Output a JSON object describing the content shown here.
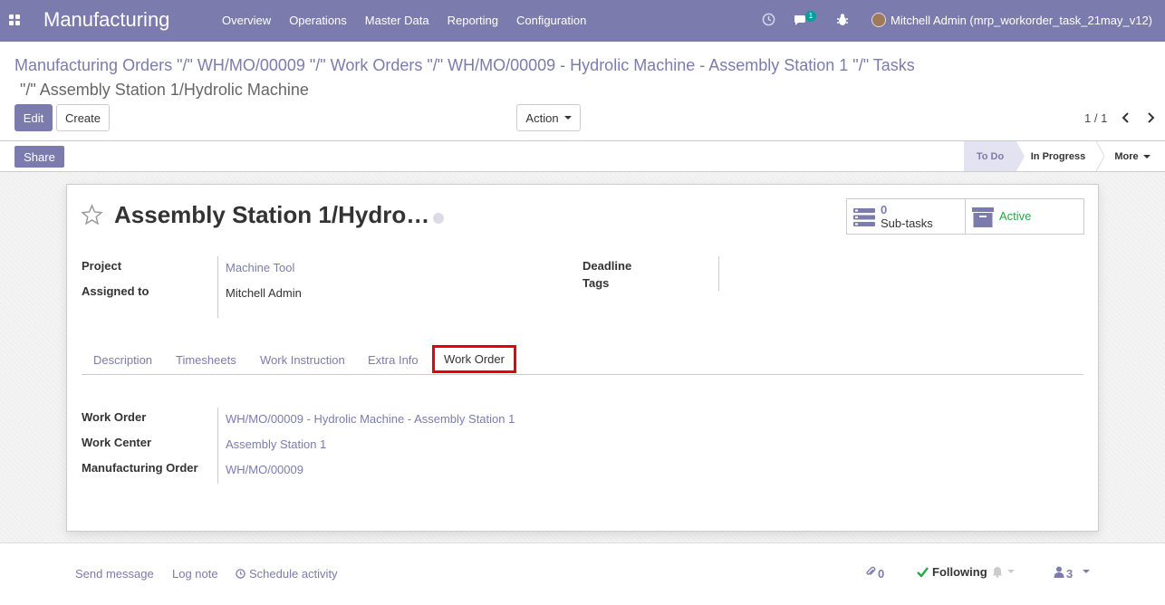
{
  "navbar": {
    "app_title": "Manufacturing",
    "menu": [
      "Overview",
      "Operations",
      "Master Data",
      "Reporting",
      "Configuration"
    ],
    "messages_badge": "1",
    "user_name": "Mitchell Admin (mrp_workorder_task_21may_v12)"
  },
  "breadcrumb": {
    "links": "Manufacturing Orders \"/\" WH/MO/00009 \"/\" Work Orders \"/\" WH/MO/00009 - Hydrolic Machine - Assembly Station 1 \"/\" Tasks",
    "current": "\"/\" Assembly Station 1/Hydrolic Machine"
  },
  "buttons": {
    "edit": "Edit",
    "create": "Create",
    "action": "Action",
    "share": "Share"
  },
  "pager": "1 / 1",
  "stages": {
    "todo": "To Do",
    "in_progress": "In Progress",
    "more": "More"
  },
  "record": {
    "title": "Assembly Station 1/Hydro…",
    "subtasks_count": "0",
    "subtasks_label": "Sub-tasks",
    "active_label": "Active"
  },
  "fields": {
    "project_label": "Project",
    "project_value": "Machine Tool",
    "assigned_label": "Assigned to",
    "assigned_value": "Mitchell Admin",
    "deadline_label": "Deadline",
    "tags_label": "Tags"
  },
  "tabs": [
    "Description",
    "Timesheets",
    "Work Instruction",
    "Extra Info",
    "Work Order"
  ],
  "work_order": {
    "wo_label": "Work Order",
    "wo_value": "WH/MO/00009 - Hydrolic Machine - Assembly Station 1",
    "wc_label": "Work Center",
    "wc_value": "Assembly Station 1",
    "mo_label": "Manufacturing Order",
    "mo_value": "WH/MO/00009"
  },
  "chatter": {
    "send_message": "Send message",
    "log_note": "Log note",
    "schedule_activity": "Schedule activity",
    "attachments": "0",
    "following": "Following",
    "followers": "3"
  },
  "colors": {
    "brand": "#7c7bad",
    "highlight": "#ee0000",
    "active": "#28a745"
  }
}
